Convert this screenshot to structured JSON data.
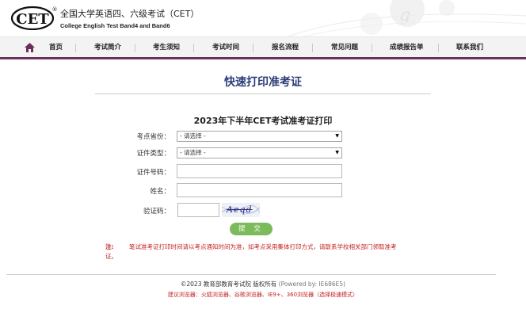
{
  "header": {
    "logo_text": "CET",
    "logo_mark": "®",
    "title": "全国大学英语四、六级考试（CET）",
    "subtitle": "College English Test Band4 and Band6"
  },
  "nav": {
    "home_icon": "home-icon",
    "items": [
      "首页",
      "考试简介",
      "考生须知",
      "考试时间",
      "报名流程",
      "常见问题",
      "成绩报告单",
      "联系我们"
    ],
    "accent_color": "#6b2f5f"
  },
  "main": {
    "page_title": "快速打印准考证",
    "form_title": "2023年下半年CET考试准考证打印",
    "fields": {
      "province_label": "考点省份：",
      "province_value": "- 请选择 -",
      "cert_type_label": "证件类型：",
      "cert_type_value": "- 请选择 -",
      "cert_no_label": "证件号码：",
      "name_label": "姓名：",
      "captcha_label": "验证码：",
      "captcha_text": "Aeqd"
    },
    "submit_label": "提 交",
    "note_label": "注:",
    "note_text": "笔试准考证打印时间请以考点通知时间为准，如考点采用集体打印方式，请联系学校相关部门领取准考证。"
  },
  "footer": {
    "copyright": "©2023  教育部教育考试院  版权所有",
    "powered": "(Powered by: IE686E5)",
    "browser_tip": "建议浏览器：火狐浏览器、谷歌浏览器、IE9+、360浏览器（选择极速模式）"
  }
}
